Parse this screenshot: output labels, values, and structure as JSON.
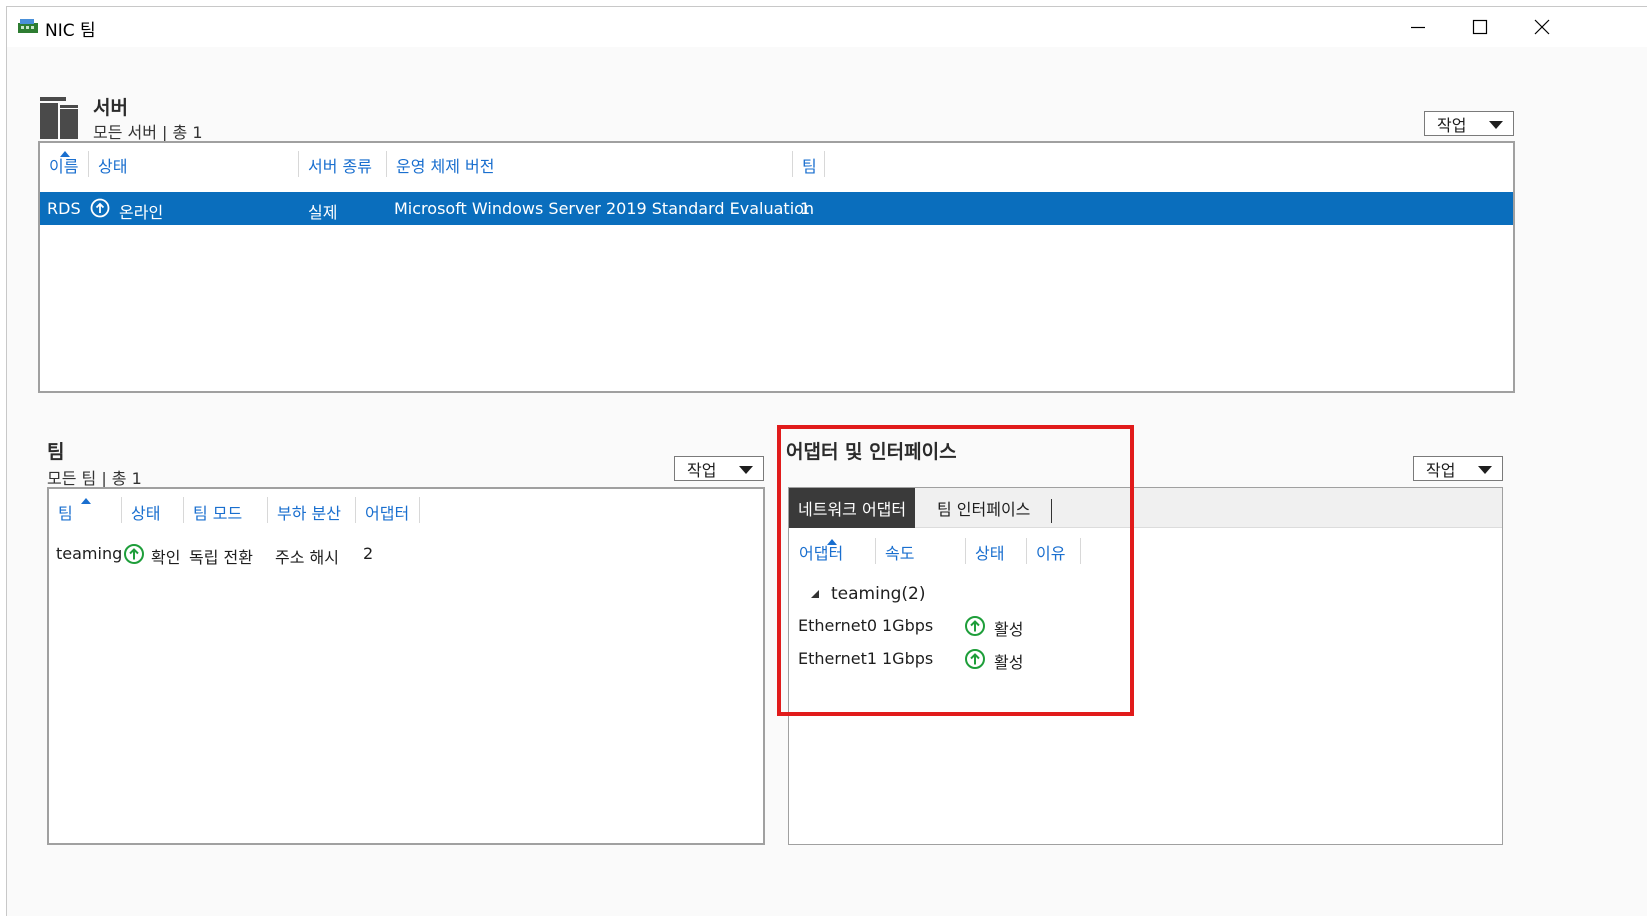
{
  "window": {
    "title": "NIC 팀"
  },
  "servers": {
    "title": "서버",
    "subtitle": "모든 서버 | 총 1",
    "task_label": "작업",
    "columns": [
      "이름",
      "상태",
      "서버 종류",
      "운영 체제 버전",
      "팀"
    ],
    "rows": [
      {
        "name": "RDS",
        "status": "온라인",
        "type": "실제",
        "os": "Microsoft Windows Server 2019 Standard Evaluation",
        "teams": "1"
      }
    ]
  },
  "teams": {
    "title": "팀",
    "subtitle": "모든 팀 | 총 1",
    "task_label": "작업",
    "columns": [
      "팀",
      "상태",
      "팀 모드",
      "부하 분산",
      "어댑터"
    ],
    "rows": [
      {
        "name": "teaming",
        "status": "확인",
        "mode": "독립 전환",
        "balancing": "주소 해시",
        "adapters": "2"
      }
    ]
  },
  "adapters": {
    "title": "어댑터 및 인터페이스",
    "task_label": "작업",
    "tabs": [
      "네트워크 어댑터",
      "팀 인터페이스"
    ],
    "columns": [
      "어댑터",
      "속도",
      "상태",
      "이유"
    ],
    "group": "teaming(2)",
    "rows": [
      {
        "name": "Ethernet0",
        "speed": "1Gbps",
        "status": "활성"
      },
      {
        "name": "Ethernet1",
        "speed": "1Gbps",
        "status": "활성"
      }
    ]
  },
  "colors": {
    "selection": "#0a6ebd",
    "link": "#1a6fcf",
    "status_ok": "#1e9e3a",
    "highlight_box": "#e11b1b"
  }
}
